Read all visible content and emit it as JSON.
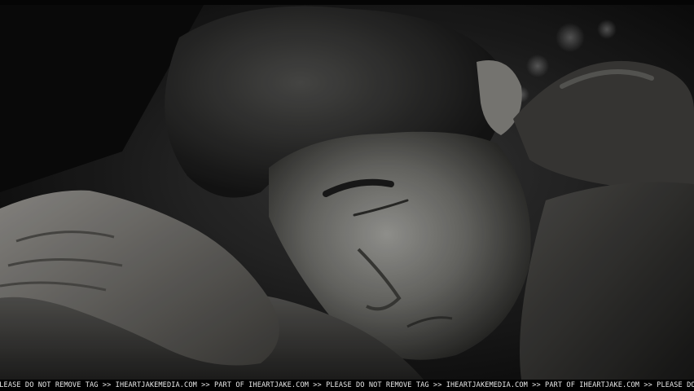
{
  "watermark": {
    "text": "PLEASE DO NOT REMOVE TAG >> IHEARTJAKEMEDIA.COM >> PART OF IHEARTJAKE.COM >> PLEASE DO NOT REMOVE TAG >> IHEARTJAKEMEDIA.COM >> PART OF IHEARTJAKE.COM >> PLEASE DO NOT REMOVE TAG >> IHEARTJAKE"
  },
  "colors": {
    "background": "#050505",
    "tag_text": "#e8e8e8"
  }
}
